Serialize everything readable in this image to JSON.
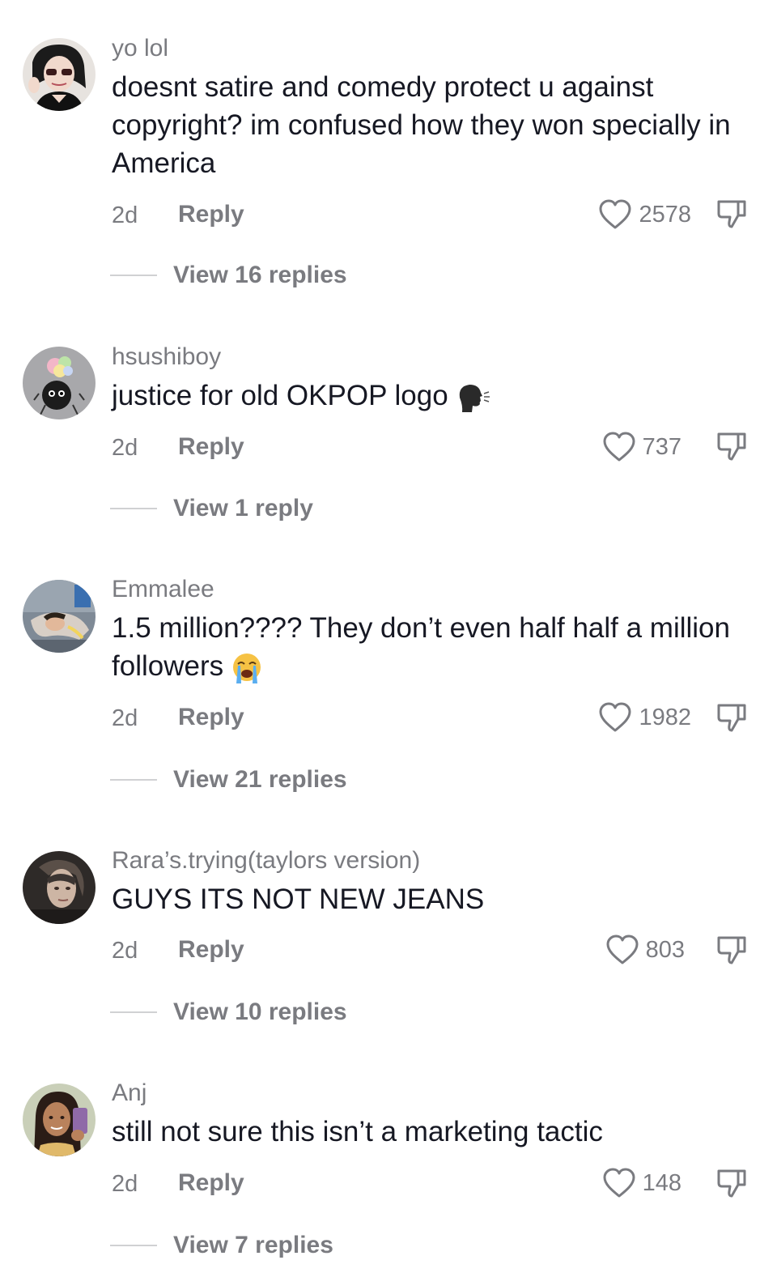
{
  "comments": [
    {
      "username": "yo lol",
      "text": "doesnt satire and comedy protect u against copyright? im confused how they won specially in America",
      "time": "2d",
      "reply_label": "Reply",
      "likes": "2578",
      "view_replies": "View 16 replies",
      "avatar_icon": "profile-photo-woman-sunglasses"
    },
    {
      "username": "hsushiboy",
      "text": "justice for old OKPOP logo",
      "emoji": "speaking-head-emoji",
      "time": "2d",
      "reply_label": "Reply",
      "likes": "737",
      "view_replies": "View 1 reply",
      "avatar_icon": "profile-cartoon-soot-sprite"
    },
    {
      "username": "Emmalee",
      "text": "1.5 million???? They don’t even half half a million followers",
      "emoji": "loudly-crying-face-emoji",
      "time": "2d",
      "reply_label": "Reply",
      "likes": "1982",
      "view_replies": "View 21 replies",
      "avatar_icon": "profile-photo-person-lying"
    },
    {
      "username": "Rara’s.trying(taylors version)",
      "text": "GUYS ITS NOT NEW JEANS",
      "time": "2d",
      "reply_label": "Reply",
      "likes": "803",
      "view_replies": "View 10 replies",
      "avatar_icon": "profile-photo-portrait-dark"
    },
    {
      "username": "Anj",
      "text": "still not sure this isn’t a marketing tactic",
      "time": "2d",
      "reply_label": "Reply",
      "likes": "148",
      "view_replies": "View 7 replies",
      "avatar_icon": "profile-photo-selfie"
    }
  ],
  "colors": {
    "text": "#161823",
    "secondary": "#7a7b80",
    "divider": "#d0d1d3"
  }
}
